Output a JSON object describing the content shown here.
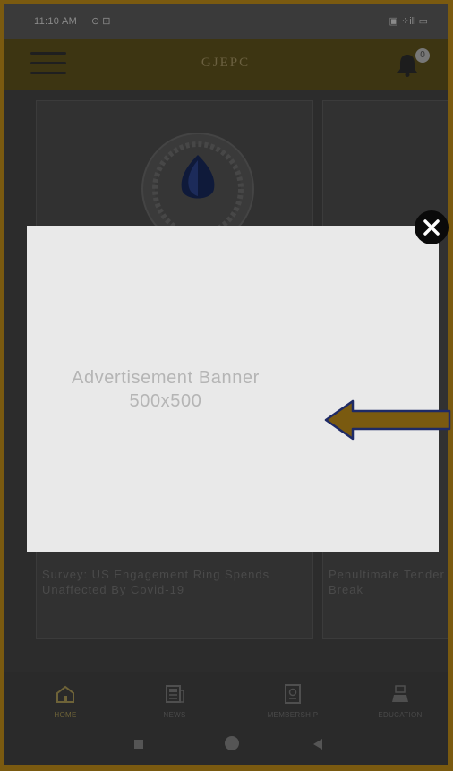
{
  "status_bar": {
    "time": "11:10 AM",
    "left_icons": "⊙ ⊡",
    "right_icons": "▣ ⁘ill ▭"
  },
  "app_bar": {
    "title": "GJEPC",
    "notification_count": "0"
  },
  "cards": [
    {
      "headline": "Survey: US Engagement Ring Spends Unaffected By Covid-19"
    },
    {
      "headline": "Penultimate Tender Break"
    }
  ],
  "ad_overlay": {
    "line1": "Advertisement Banner",
    "line2": "500x500"
  },
  "bottom_nav": {
    "items": [
      {
        "label": "HOME",
        "icon": "home-icon"
      },
      {
        "label": "NEWS",
        "icon": "newspaper-icon"
      },
      {
        "label": "MEMBERSHIP",
        "icon": "membership-icon"
      },
      {
        "label": "EDUCATION",
        "icon": "education-icon"
      }
    ]
  },
  "colors": {
    "frame": "#7a5a10",
    "arrow": "#7a5a10",
    "banner": "#e9e9e9",
    "close": "#0a0a0a"
  }
}
